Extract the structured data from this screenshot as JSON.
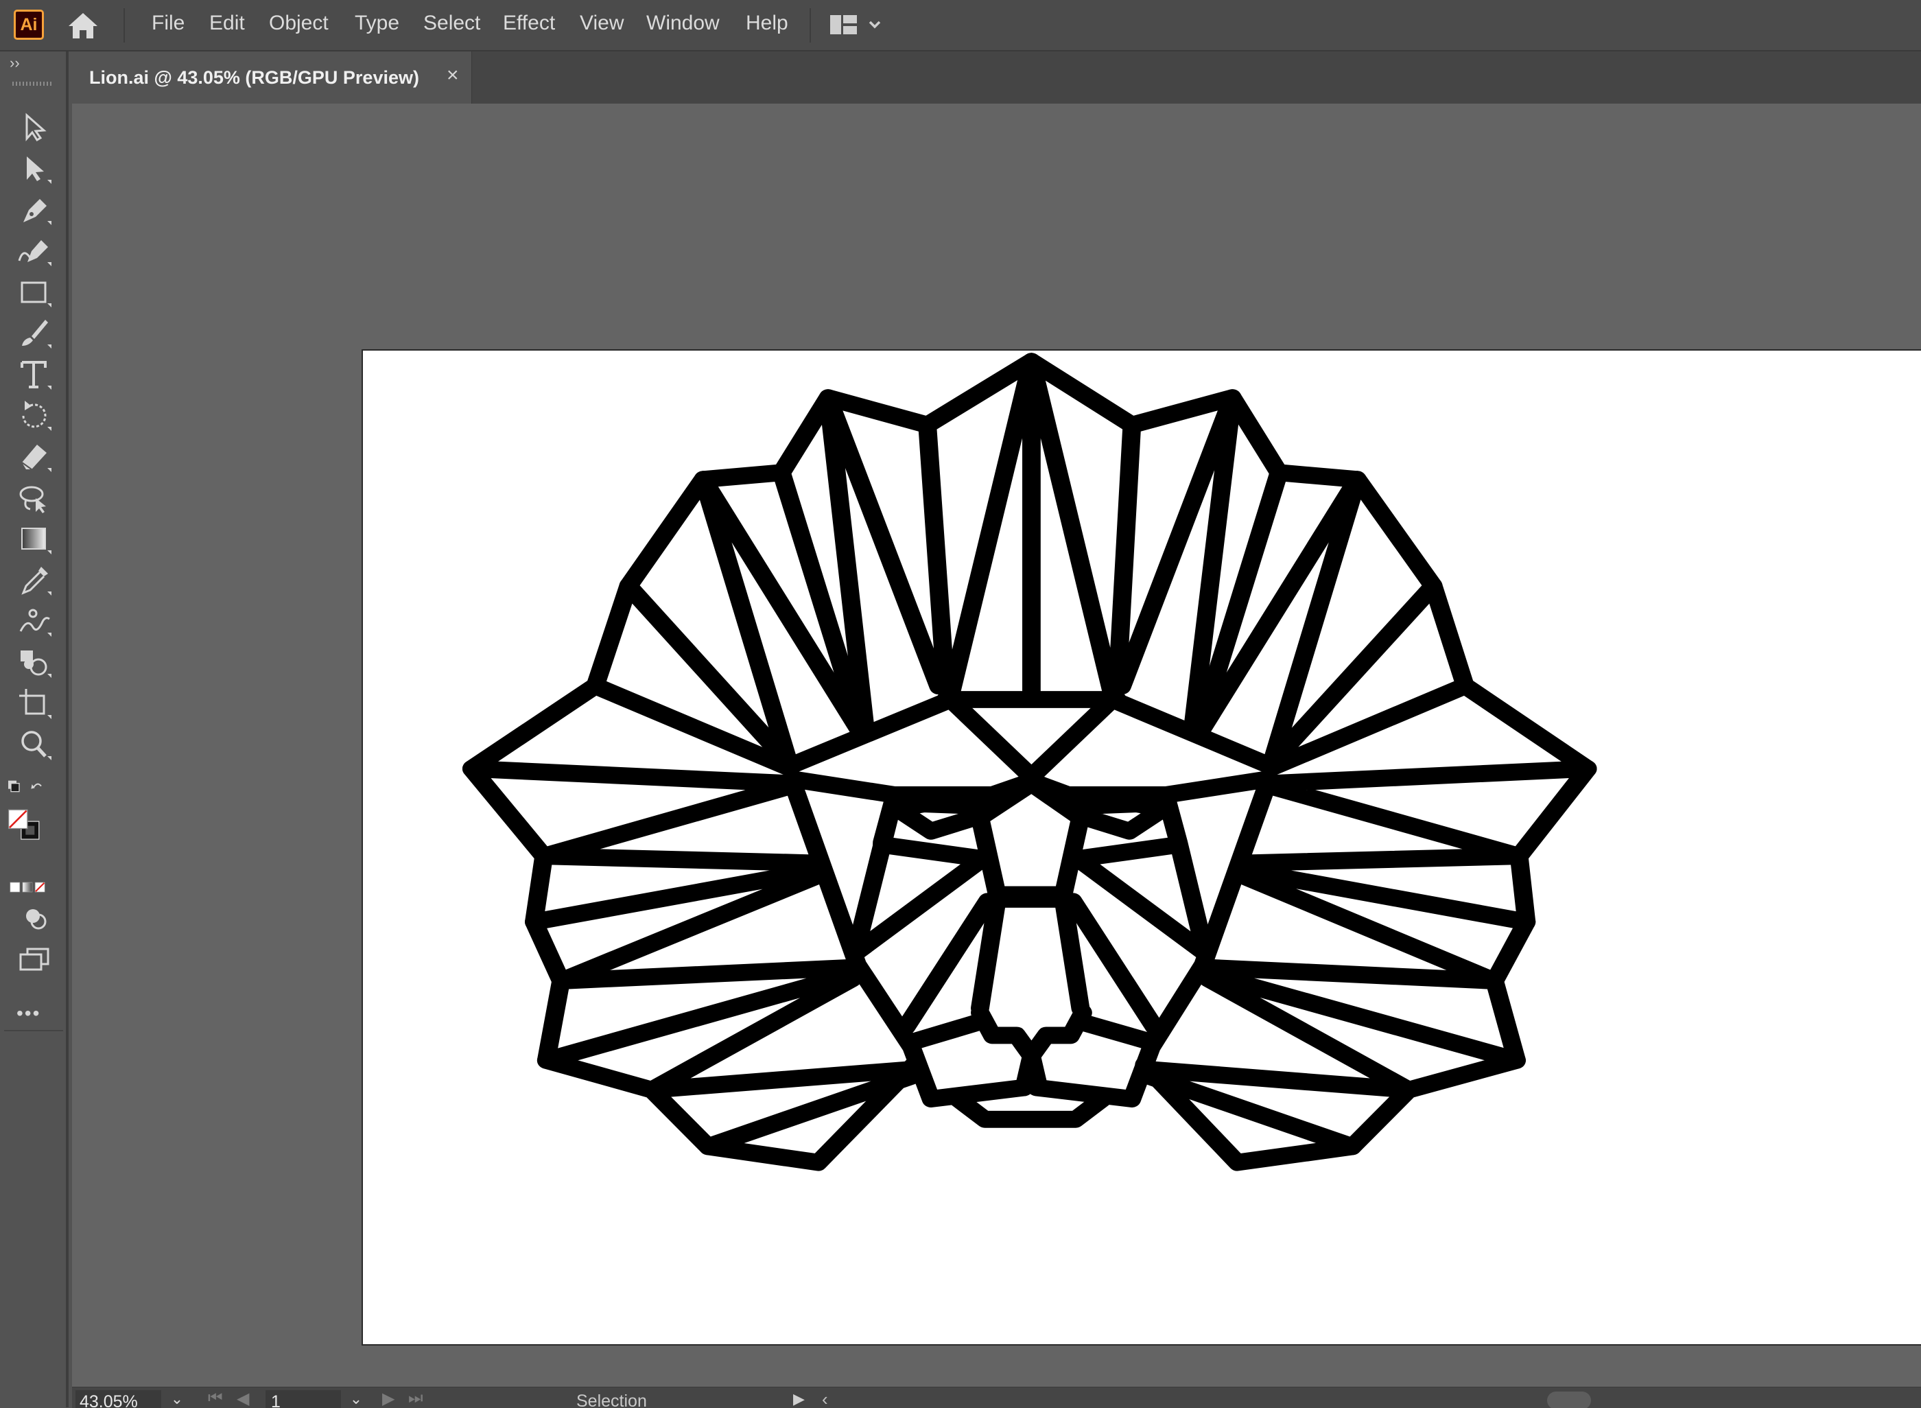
{
  "app": {
    "logo_text": "Ai",
    "accent_color": "#f7a23a"
  },
  "menubar": {
    "items": [
      "File",
      "Edit",
      "Object",
      "Type",
      "Select",
      "Effect",
      "View",
      "Window",
      "Help"
    ],
    "home_icon": "home-icon",
    "workspace_icon": "workspace-switcher-icon"
  },
  "document_tab": {
    "title": "Lion.ai @ 43.05% (RGB/GPU Preview)",
    "close_glyph": "×"
  },
  "toolbar": {
    "collapse_glyph": "››",
    "tools": [
      "selection-tool",
      "direct-selection-tool",
      "pen-tool",
      "curvature-tool",
      "rectangle-tool",
      "paintbrush-tool",
      "type-tool",
      "rotate-tool",
      "eraser-tool",
      "lasso-tool",
      "gradient-tool",
      "eyedropper-tool",
      "puppet-warp-tool",
      "shape-builder-tool",
      "artboard-tool",
      "zoom-tool"
    ],
    "fill_stroke": {
      "fill": "none",
      "stroke": "#000000"
    },
    "more_glyph": "•••"
  },
  "artwork": {
    "stroke_color": "#000000",
    "background": "#ffffff"
  },
  "statusbar": {
    "zoom": "43.05%",
    "artboard_number": "1",
    "mode": "Selection",
    "dropdown_glyph": "⌄"
  }
}
